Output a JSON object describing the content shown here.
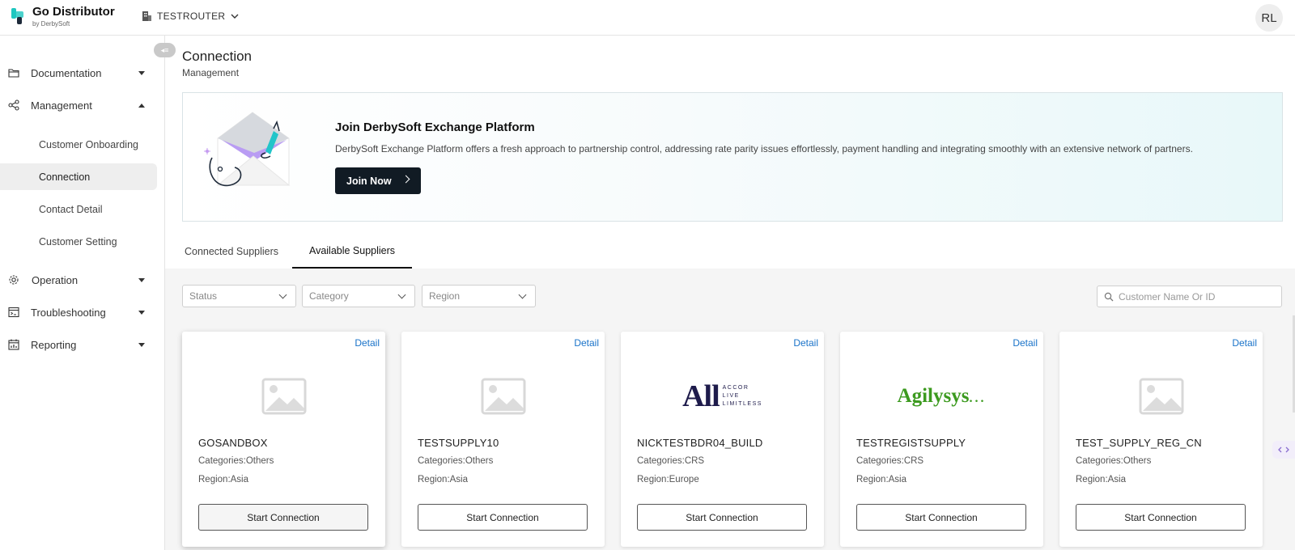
{
  "header": {
    "brand_name": "Go Distributor",
    "brand_sub": "by DerbySoft",
    "tenant": "TESTROUTER",
    "avatar_initials": "RL"
  },
  "sidebar": {
    "collapse_glyph": "◂≡",
    "items": [
      {
        "label": "Documentation",
        "icon": "folder-icon",
        "expanded": false
      },
      {
        "label": "Management",
        "icon": "share-nodes-icon",
        "expanded": true,
        "children": [
          "Customer Onboarding",
          "Connection",
          "Contact Detail",
          "Customer Setting"
        ],
        "active_child": "Connection"
      },
      {
        "label": "Operation",
        "icon": "gear-icon",
        "expanded": false
      },
      {
        "label": "Troubleshooting",
        "icon": "terminal-window-icon",
        "expanded": false
      },
      {
        "label": "Reporting",
        "icon": "calendar-chart-icon",
        "expanded": false
      }
    ]
  },
  "page": {
    "title": "Connection",
    "breadcrumb": "Management"
  },
  "banner": {
    "title": "Join DerbySoft Exchange Platform",
    "description": "DerbySoft Exchange Platform offers a fresh approach to partnership control, addressing rate parity issues effortlessly, payment handling and integrating smoothly with an extensive network of partners.",
    "button_label": "Join Now"
  },
  "tabs": [
    {
      "label": "Connected Suppliers",
      "active": false
    },
    {
      "label": "Available Suppliers",
      "active": true
    }
  ],
  "filters": {
    "status_placeholder": "Status",
    "category_placeholder": "Category",
    "region_placeholder": "Region",
    "search_placeholder": "Customer Name Or ID"
  },
  "cards": [
    {
      "name": "GOSANDBOX",
      "categories_label": "Categories:",
      "categories": "Others",
      "region_label": "Region:",
      "region": "Asia",
      "detail_label": "Detail",
      "button_label": "Start Connection",
      "logo": "placeholder-image"
    },
    {
      "name": "TESTSUPPLY10",
      "categories_label": "Categories:",
      "categories": "Others",
      "region_label": "Region:",
      "region": "Asia",
      "detail_label": "Detail",
      "button_label": "Start Connection",
      "logo": "placeholder-image"
    },
    {
      "name": "NICKTESTBDR04_BUILD",
      "categories_label": "Categories:",
      "categories": "CRS",
      "region_label": "Region:",
      "region": "Europe",
      "detail_label": "Detail",
      "button_label": "Start Connection",
      "logo": "accor-logo",
      "logo_text": {
        "big": "All",
        "line1": "ACCOR",
        "line2": "LIVE",
        "line3": "LIMITLESS"
      }
    },
    {
      "name": "TESTREGISTSUPPLY",
      "categories_label": "Categories:",
      "categories": "CRS",
      "region_label": "Region:",
      "region": "Asia",
      "detail_label": "Detail",
      "button_label": "Start Connection",
      "logo": "agilysys-logo",
      "logo_text": {
        "word": "Agilysys",
        "dots": "..."
      }
    },
    {
      "name": "TEST_SUPPLY_REG_CN",
      "categories_label": "Categories:",
      "categories": "Others",
      "region_label": "Region:",
      "region": "Asia",
      "detail_label": "Detail",
      "button_label": "Start Connection",
      "logo": "placeholder-image"
    }
  ],
  "colors": {
    "accent_link": "#1a73c9",
    "join_button": "#111b24",
    "brand_logo": "#1fc7c0",
    "agilysys_green": "#3c9a1f",
    "accor_navy": "#1e1b4b"
  }
}
